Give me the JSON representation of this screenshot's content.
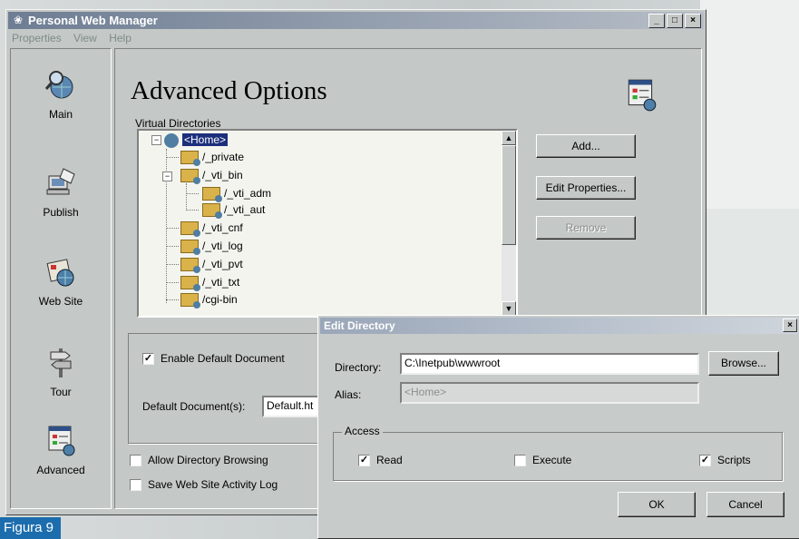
{
  "window": {
    "title": "Personal Web Manager",
    "controls": {
      "minimize": "_",
      "maximize": "□",
      "close": "×"
    }
  },
  "menu": [
    "Properties",
    "View",
    "Help"
  ],
  "nav": [
    {
      "label": "Main",
      "icon": "magnifier-globe-icon"
    },
    {
      "label": "Publish",
      "icon": "publish-icon"
    },
    {
      "label": "Web Site",
      "icon": "web-site-icon"
    },
    {
      "label": "Tour",
      "icon": "tour-signpost-icon"
    },
    {
      "label": "Advanced",
      "icon": "advanced-options-icon"
    }
  ],
  "advanced": {
    "heading": "Advanced Options",
    "virtual_directories_label": "Virtual Directories",
    "tree": [
      "<Home>",
      "/_private",
      "/_vti_bin",
      "/_vti_adm",
      "/_vti_aut",
      "/_vti_cnf",
      "/_vti_log",
      "/_vti_pvt",
      "/_vti_txt",
      "/cgi-bin"
    ],
    "buttons": {
      "add": "Add...",
      "edit": "Edit Properties...",
      "remove": "Remove"
    },
    "enable_default_document": {
      "label": "Enable Default Document",
      "checked": true
    },
    "default_documents": {
      "label": "Default Document(s):",
      "value": "Default.ht"
    },
    "allow_directory_browsing": {
      "label": "Allow Directory Browsing",
      "checked": false
    },
    "save_activity_log": {
      "label": "Save Web Site Activity Log",
      "checked": false
    }
  },
  "edit_dialog": {
    "title": "Edit Directory",
    "directory_label": "Directory:",
    "directory_value": "C:\\Inetpub\\wwwroot",
    "browse": "Browse...",
    "alias_label": "Alias:",
    "alias_value": "<Home>",
    "access_label": "Access",
    "read": {
      "label": "Read",
      "checked": true
    },
    "execute": {
      "label": "Execute",
      "checked": false
    },
    "scripts": {
      "label": "Scripts",
      "checked": true
    },
    "ok": "OK",
    "cancel": "Cancel"
  },
  "caption": "Figura 9",
  "colors": {
    "caption_bg": "#1c6dad",
    "tree_selection": "#1c2f7c",
    "titlebar": "#6e7d93"
  }
}
